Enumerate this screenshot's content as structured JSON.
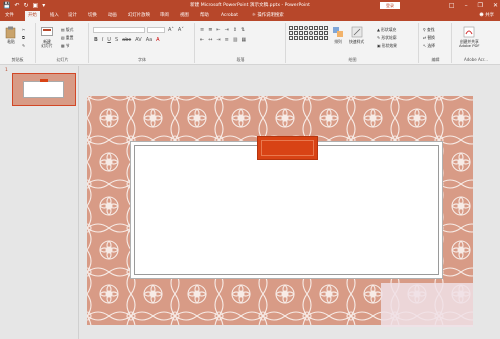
{
  "titlebar": {
    "title": "新建 Microsoft PowerPoint 演示文稿.pptx  -  PowerPoint",
    "signin": "登录",
    "qat_icons": [
      "save-icon",
      "undo-icon",
      "redo-icon",
      "start-from-beginning-icon",
      "customize-qat-icon"
    ],
    "window_controls": [
      "minimize-icon",
      "restore-icon",
      "close-icon"
    ]
  },
  "tabs": [
    {
      "label": "文件"
    },
    {
      "label": "开始"
    },
    {
      "label": "插入"
    },
    {
      "label": "设计"
    },
    {
      "label": "切换"
    },
    {
      "label": "动画"
    },
    {
      "label": "幻灯片放映"
    },
    {
      "label": "审阅"
    },
    {
      "label": "视图"
    },
    {
      "label": "帮助"
    },
    {
      "label": "Acrobat"
    },
    {
      "label": "操作说明搜索"
    }
  ],
  "share": "共享",
  "ribbon": {
    "clipboard": {
      "paste": "粘贴",
      "label": "剪贴板"
    },
    "slides": {
      "new_slide": "新建\n幻灯片",
      "layout": "版式",
      "reset": "重置",
      "section": "节",
      "label": "幻灯片"
    },
    "font": {
      "label": "字体"
    },
    "paragraph": {
      "label": "段落"
    },
    "drawing": {
      "arrange": "排列",
      "quick_styles": "快速样式",
      "fill": "形状填充",
      "outline": "形状轮廓",
      "effects": "形状效果",
      "label": "绘图"
    },
    "editing": {
      "find": "查找",
      "replace": "替换",
      "select": "选择",
      "label": "编辑"
    },
    "adobe": {
      "create_share": "创建并共享\nAdobe PDF",
      "label": "Adobe Acr..."
    }
  },
  "slides_pane": {
    "slide_number": "1"
  },
  "colors": {
    "accent": "#b7472a",
    "tab_orange": "#d84315",
    "pattern": "#d89b86"
  }
}
